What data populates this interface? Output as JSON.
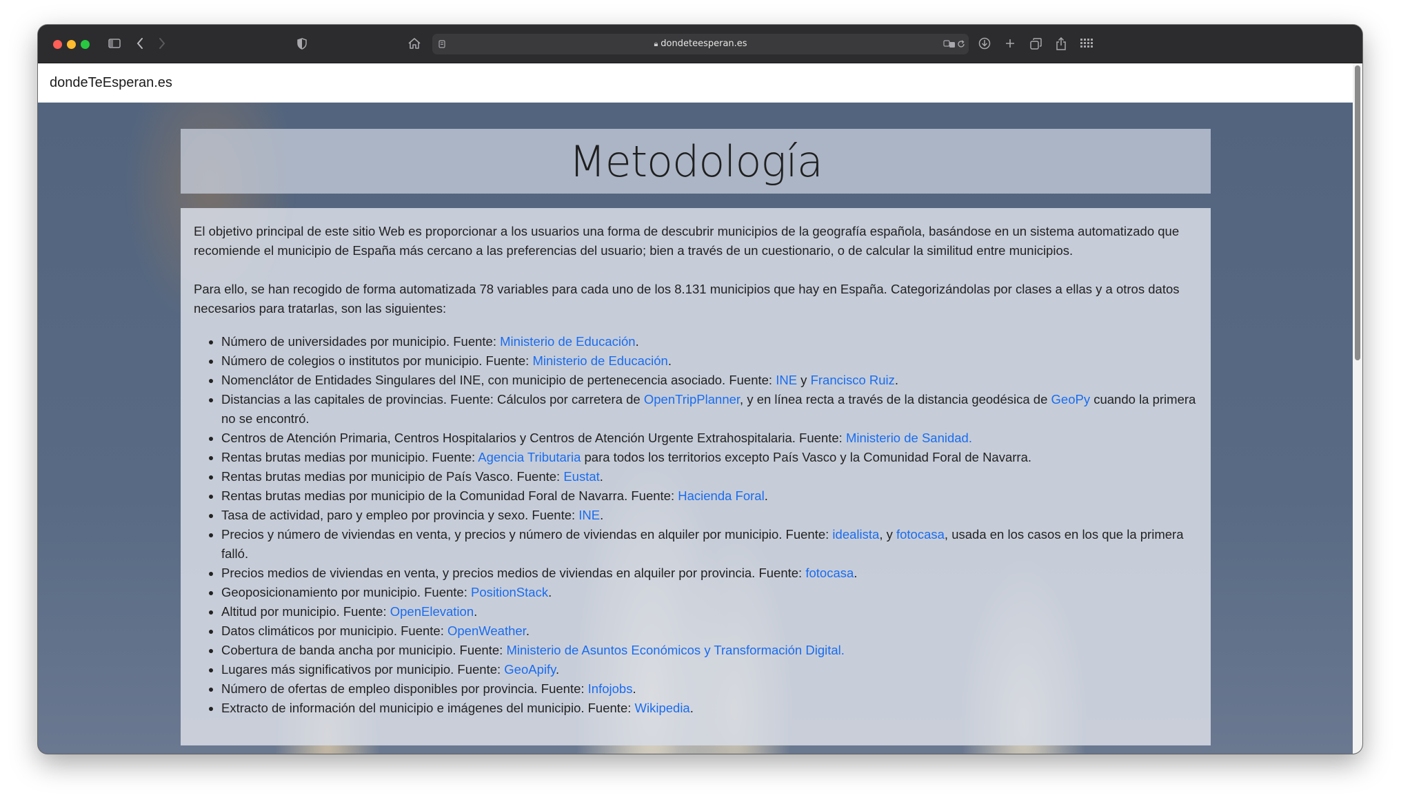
{
  "browser": {
    "url": "dondeteesperan.es"
  },
  "site": {
    "brand": "dondeTeEsperan.es",
    "title": "Metodología"
  },
  "content": {
    "p1": "El objetivo principal de este sitio Web es proporcionar a los usuarios una forma de descubrir municipios de la geografía española, basándose en un sistema automatizado que recomiende el municipio de España más cercano a las preferencias del usuario; bien a través de un cuestionario, o de calcular la similitud entre municipios.",
    "p2": "Para ello, se han recogido de forma automatizada 78 variables para cada uno de los 8.131 municipios que hay en España. Categorizándolas por clases a ellas y a otros datos necesarios para tratarlas, son las siguientes:",
    "items": [
      {
        "t1": "Número de universidades por municipio. Fuente: ",
        "l1": "Ministerio de Educación",
        "t2": "."
      },
      {
        "t1": "Número de colegios o institutos por municipio. Fuente: ",
        "l1": "Ministerio de Educación",
        "t2": "."
      },
      {
        "t1": "Nomenclátor de Entidades Singulares del INE, con municipio de pertenecencia asociado. Fuente: ",
        "l1": "INE",
        "t2": " y ",
        "l2": "Francisco Ruiz",
        "t3": "."
      },
      {
        "t1": "Distancias a las capitales de provincias. Fuente: Cálculos por carretera de ",
        "l1": "OpenTripPlanner",
        "t2": ", y en línea recta a través de la distancia geodésica de ",
        "l2": "GeoPy",
        "t3": " cuando la primera no se encontró."
      },
      {
        "t1": "Centros de Atención Primaria, Centros Hospitalarios y Centros de Atención Urgente Extrahospitalaria. Fuente: ",
        "l1": "Ministerio de Sanidad."
      },
      {
        "t1": "Rentas brutas medias por municipio. Fuente: ",
        "l1": "Agencia Tributaria",
        "t2": " para todos los territorios excepto País Vasco y la Comunidad Foral de Navarra."
      },
      {
        "t1": "Rentas brutas medias por municipio de País Vasco. Fuente: ",
        "l1": "Eustat",
        "t2": "."
      },
      {
        "t1": "Rentas brutas medias por municipio de la Comunidad Foral de Navarra. Fuente: ",
        "l1": "Hacienda Foral",
        "t2": "."
      },
      {
        "t1": "Tasa de actividad, paro y empleo por provincia y sexo. Fuente: ",
        "l1": "INE",
        "t2": "."
      },
      {
        "t1": "Precios y número de viviendas en venta, y precios y número de viviendas en alquiler por municipio. Fuente: ",
        "l1": "idealista",
        "t2": ", y ",
        "l2": "fotocasa",
        "t3": ", usada en los casos en los que la primera falló."
      },
      {
        "t1": "Precios medios de viviendas en venta, y precios medios de viviendas en alquiler por provincia. Fuente: ",
        "l1": "fotocasa",
        "t2": "."
      },
      {
        "t1": "Geoposicionamiento por municipio. Fuente: ",
        "l1": "PositionStack",
        "t2": "."
      },
      {
        "t1": "Altitud por municipio. Fuente: ",
        "l1": "OpenElevation",
        "t2": "."
      },
      {
        "t1": "Datos climáticos por municipio. Fuente: ",
        "l1": "OpenWeather",
        "t2": "."
      },
      {
        "t1": "Cobertura de banda ancha por municipio. Fuente: ",
        "l1": "Ministerio de Asuntos Económicos y Transformación Digital."
      },
      {
        "t1": "Lugares más significativos por municipio. Fuente: ",
        "l1": "GeoApify",
        "t2": "."
      },
      {
        "t1": "Número de ofertas de empleo disponibles por provincia. Fuente: ",
        "l1": "Infojobs",
        "t2": "."
      },
      {
        "t1": "Extracto de información del municipio e imágenes del municipio. Fuente: ",
        "l1": "Wikipedia",
        "t2": "."
      }
    ]
  },
  "colors": {
    "link": "#1a6cf0",
    "toolbar": "#2c2c2e"
  }
}
